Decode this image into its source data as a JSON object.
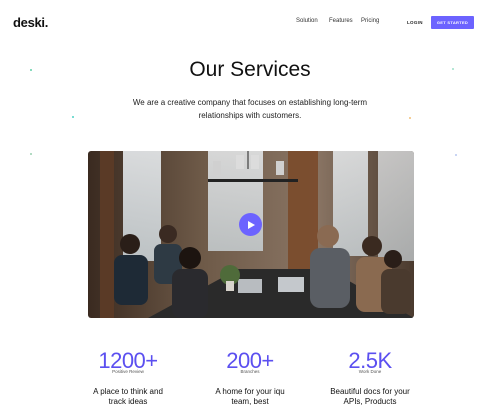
{
  "nav": {
    "logo": "deski.",
    "links": [
      "Solution",
      "Features",
      "Pricing"
    ],
    "login_label": "LOGIN",
    "cta_label": "GET STARTED"
  },
  "hero": {
    "title": "Our Services",
    "subtitle": "We are a creative company that focuses on establishing long-term relationships with customers."
  },
  "video": {
    "play_icon": "play-icon"
  },
  "stats": [
    {
      "value": "1200+",
      "label": "Positive Review",
      "description": "A place to think and track ideas"
    },
    {
      "value": "200+",
      "label": "Branches",
      "description": "A home for your iqu team, best"
    },
    {
      "value": "2.5K",
      "label": "Work Done",
      "description": "Beautiful docs for your APIs, Products"
    }
  ],
  "colors": {
    "accent": "#6c63ff",
    "stat_text": "#5b4ff0"
  }
}
